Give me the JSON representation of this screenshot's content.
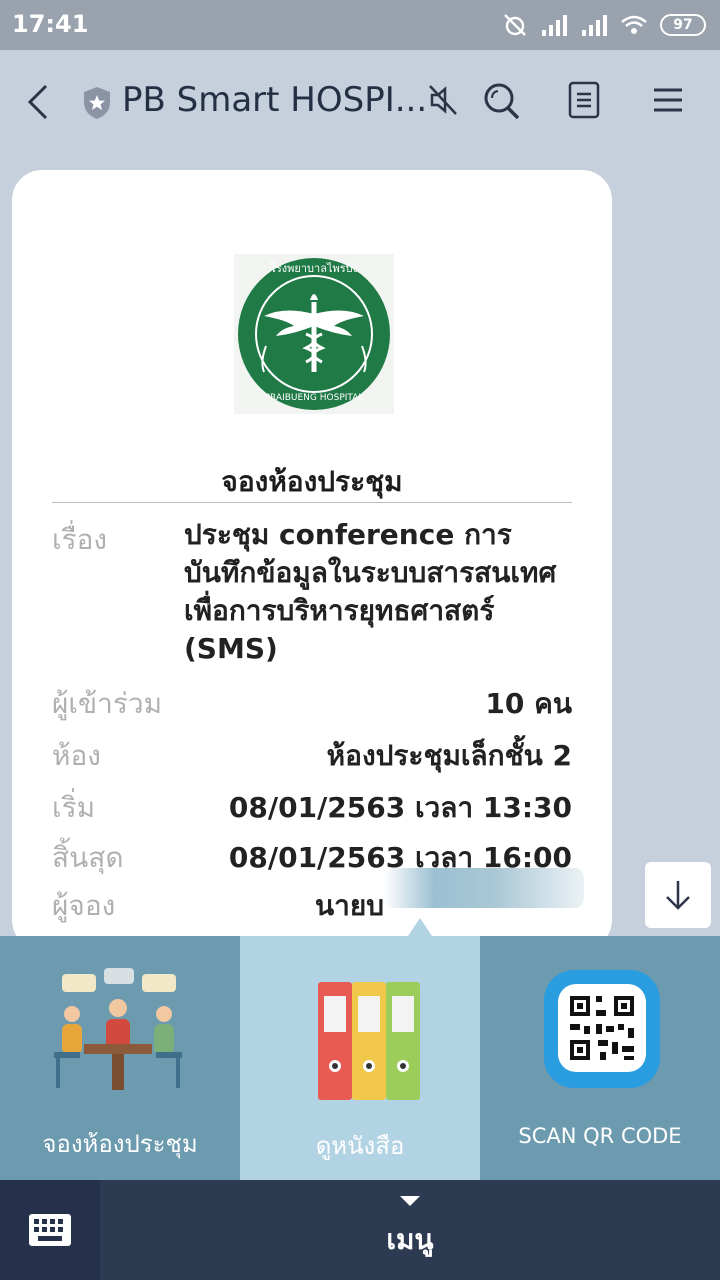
{
  "status_bar": {
    "time": "17:41",
    "battery": "97"
  },
  "header": {
    "title": "PB Smart HOSPI...",
    "icons": [
      "back-arrow-icon",
      "shield-star-icon",
      "mute-icon",
      "search-icon",
      "notes-icon",
      "menu-icon"
    ]
  },
  "card": {
    "logo_text_top": "โรงพยาบาลไพรบึง",
    "logo_text_bottom": "PRAIBUENG HOSPITAL",
    "title": "จองห้องประชุม",
    "fields": {
      "subject_label": "เรื่อง",
      "subject_value": "ประชุม conference การบันทึกข้อมูลในระบบสารสนเทศเพื่อการบริหารยุทธศาสตร์ (SMS)",
      "attendees_label": "ผู้เข้าร่วม",
      "attendees_value": "10 คน",
      "room_label": "ห้อง",
      "room_value": "ห้องประชุมเล็กชั้น 2",
      "start_label": "เริ่ม",
      "start_value": "08/01/2563 เวลา 13:30",
      "end_label": "สิ้นสุด",
      "end_value": "08/01/2563 เวลา 16:00",
      "booker_label": "ผู้จอง",
      "booker_value": "นายบ"
    }
  },
  "rich_menu": {
    "items": [
      {
        "label": "จองห้องประชุม",
        "icon": "meeting-people-icon"
      },
      {
        "label": "ดูหนังสือ",
        "icon": "binders-icon"
      },
      {
        "label": "SCAN QR CODE",
        "icon": "qr-code-icon"
      }
    ]
  },
  "bottom_bar": {
    "menu_label": "เมนู",
    "icons": [
      "keyboard-icon",
      "caret-down-icon"
    ]
  },
  "colors": {
    "header_bg": "#c6cfdc",
    "status_bg": "#9aa2ad",
    "menu_tile_dark": "#6c9aae",
    "menu_tile_light": "#b2d3e3",
    "bottom_bar": "#2c3a52",
    "logo_green": "#1f7a45"
  }
}
